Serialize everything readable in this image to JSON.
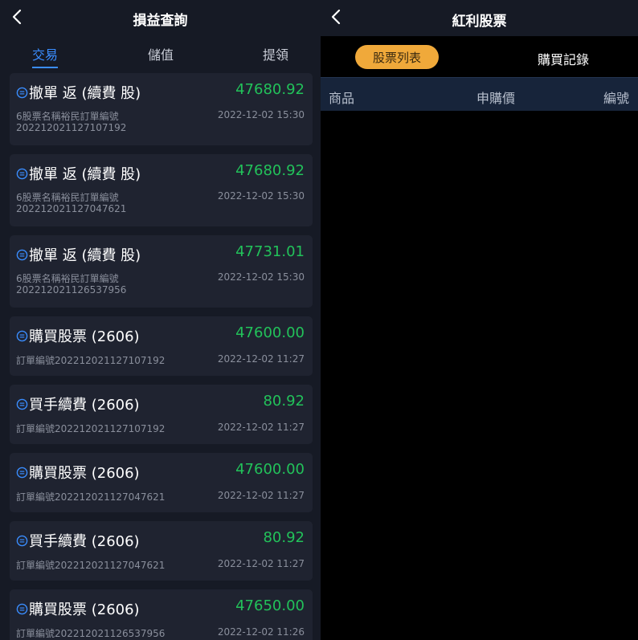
{
  "left": {
    "title": "損益查詢",
    "tabs": [
      {
        "label": "交易",
        "active": true
      },
      {
        "label": "儲值",
        "active": false
      },
      {
        "label": "提領",
        "active": false
      }
    ],
    "records": [
      {
        "title": "撤單 返 (續費 股)",
        "amount": "47680.92",
        "line1": "6股票名稱裕民訂單編號",
        "line2": "202212021127107192",
        "time": "2022-12-02 15:30"
      },
      {
        "title": "撤單 返 (續費 股)",
        "amount": "47680.92",
        "line1": "6股票名稱裕民訂單編號",
        "line2": "202212021127047621",
        "time": "2022-12-02 15:30"
      },
      {
        "title": "撤單 返 (續費 股)",
        "amount": "47731.01",
        "line1": "6股票名稱裕民訂單編號",
        "line2": "202212021126537956",
        "time": "2022-12-02 15:30"
      },
      {
        "title": "購買股票 (2606)",
        "amount": "47600.00",
        "line1": "訂單編號202212021127107192",
        "line2": "",
        "time": "2022-12-02 11:27"
      },
      {
        "title": "買手續費 (2606)",
        "amount": "80.92",
        "line1": "訂單編號202212021127107192",
        "line2": "",
        "time": "2022-12-02 11:27"
      },
      {
        "title": "購買股票 (2606)",
        "amount": "47600.00",
        "line1": "訂單編號202212021127047621",
        "line2": "",
        "time": "2022-12-02 11:27"
      },
      {
        "title": "買手續費 (2606)",
        "amount": "80.92",
        "line1": "訂單編號202212021127047621",
        "line2": "",
        "time": "2022-12-02 11:27"
      },
      {
        "title": "購買股票 (2606)",
        "amount": "47650.00",
        "line1": "訂單編號202212021126537956",
        "line2": "",
        "time": "2022-12-02 11:26"
      }
    ]
  },
  "right": {
    "title": "紅利股票",
    "tabs": [
      {
        "label": "股票列表",
        "active": true
      },
      {
        "label": "購買記錄",
        "active": false
      }
    ],
    "columns": [
      "商品",
      "申購價",
      "編號"
    ]
  },
  "colors": {
    "accent_blue": "#3a8dff",
    "amount_green": "#22c25a",
    "pill_orange": "#f0a93a"
  }
}
